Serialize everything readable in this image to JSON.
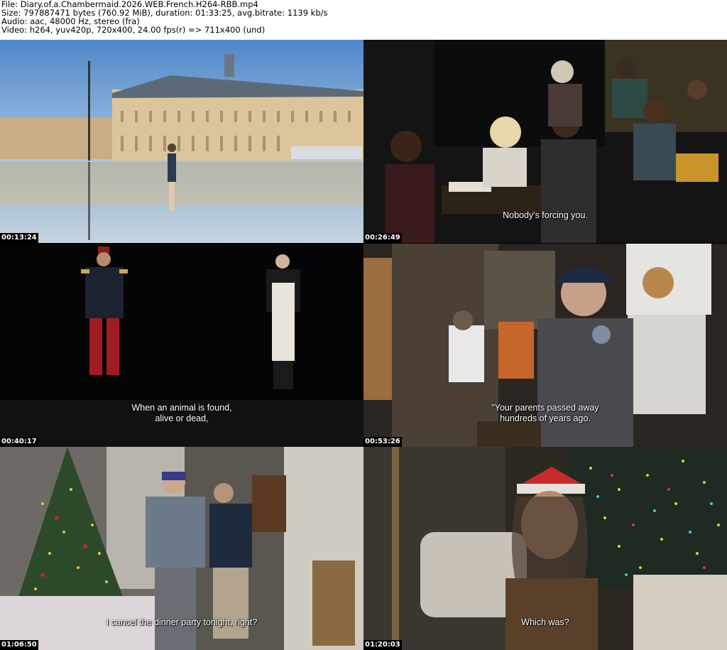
{
  "header": {
    "file": "File: Diary.of.a.Chambermaid.2026.WEB.French.H264-RBB.mp4",
    "size": "Size: 797887471 bytes (760.92 MiB), duration: 01:33:25, avg.bitrate: 1139 kb/s",
    "audio": "Audio: aac, 48000 Hz, stereo (fra)",
    "video": "Video: h264, yuv420p, 720x400, 24.00 fps(r) => 711x400 (und)"
  },
  "frames": [
    {
      "timestamp": "00:13:24",
      "subtitle": []
    },
    {
      "timestamp": "00:26:49",
      "subtitle": [
        "Nobody's forcing you."
      ]
    },
    {
      "timestamp": "00:40:17",
      "subtitle": [
        "When an animal is found,",
        "alive or dead,"
      ]
    },
    {
      "timestamp": "00:53:26",
      "subtitle": [
        "\"Your parents passed away",
        "hundreds of years ago."
      ]
    },
    {
      "timestamp": "01:06:50",
      "subtitle": [
        "I cancel the dinner party tonight, right?"
      ]
    },
    {
      "timestamp": "01:20:03",
      "subtitle": [
        "Which was?"
      ]
    }
  ]
}
